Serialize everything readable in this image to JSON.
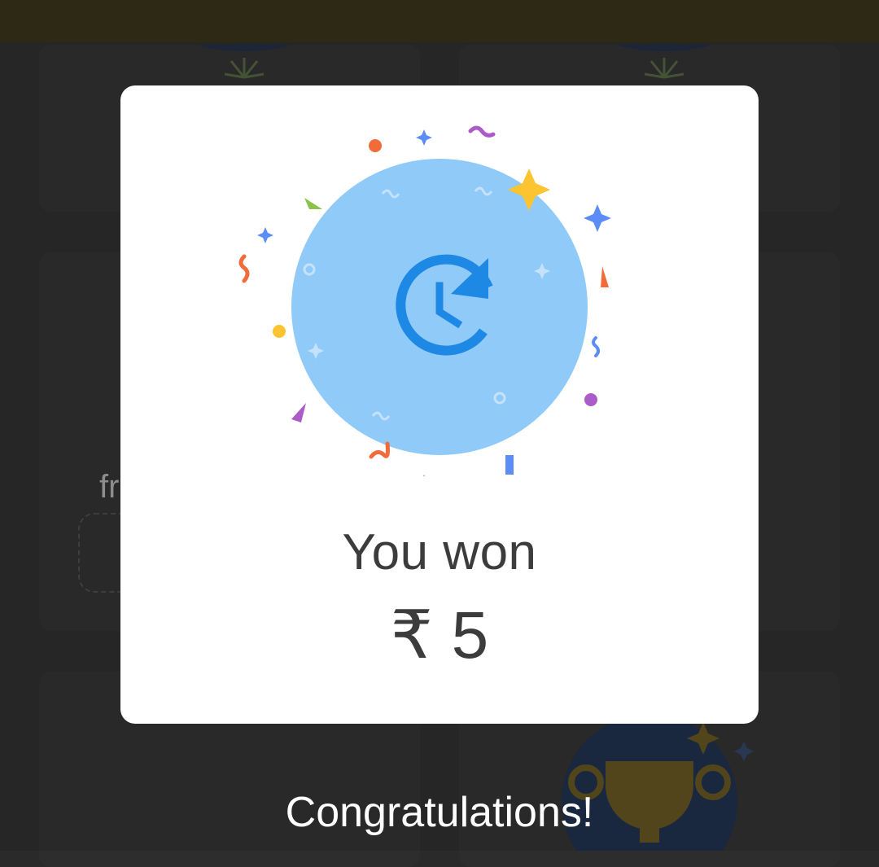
{
  "background": {
    "partial_text": "fr"
  },
  "dialog": {
    "won_label": "You won",
    "amount": "₹ 5",
    "illustration_icon": "reward-clock-icon",
    "accent_color": "#1E88E5",
    "circle_color": "#90CAF9"
  },
  "footer": {
    "message": "Congratulations!"
  },
  "colors": {
    "overlay": "#2a2a2a",
    "card_bg": "#ffffff",
    "text": "#3c3c3c",
    "top_bar": "#2e2914"
  }
}
